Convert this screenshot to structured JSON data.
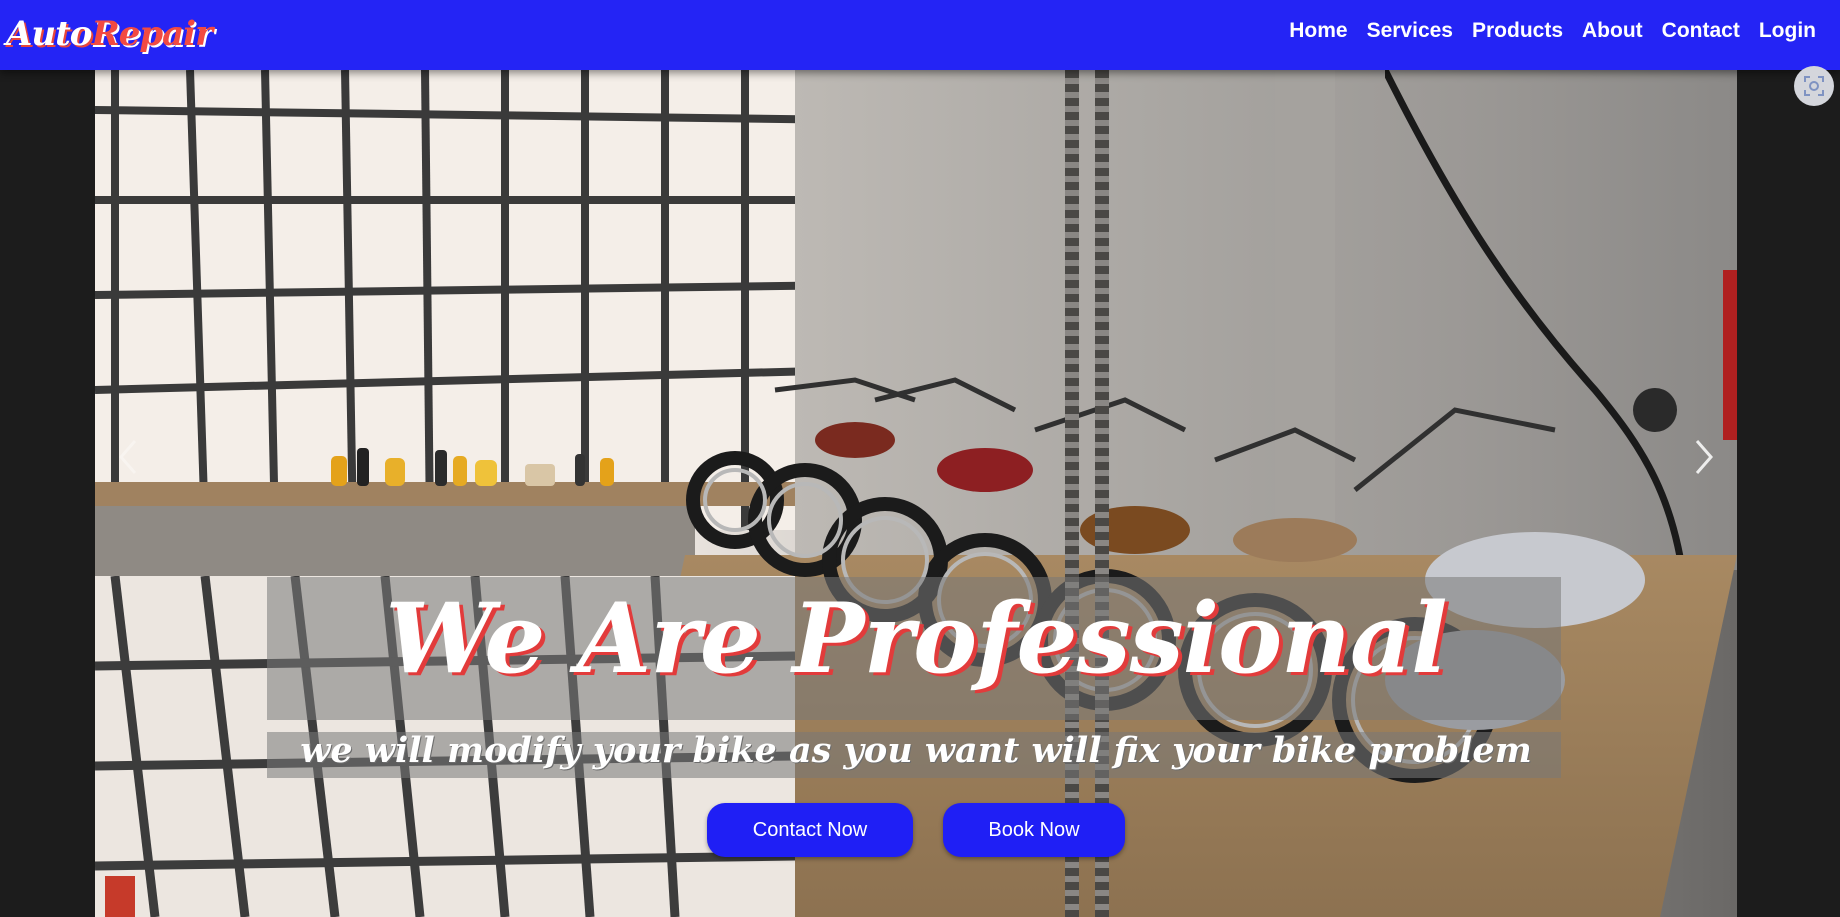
{
  "brand": {
    "part1": "Auto",
    "part2": "Repair"
  },
  "nav": {
    "items": [
      {
        "label": "Home"
      },
      {
        "label": "Services"
      },
      {
        "label": "Products"
      },
      {
        "label": "About"
      },
      {
        "label": "Contact"
      },
      {
        "label": "Login"
      }
    ]
  },
  "hero": {
    "title": "We Are Professional",
    "subtitle": "we will modify your bike as you want will fix your bike problem",
    "buttons": {
      "contact_label": "Contact Now",
      "book_label": "Book Now"
    },
    "arrows": {
      "prev_icon": "chevron-left-icon",
      "next_icon": "chevron-right-icon"
    }
  },
  "colors": {
    "navbar": "#2424f5",
    "brand_accent": "#f24a42",
    "button": "#1f1ff5",
    "title_shadow": "#e23b3b",
    "page_background": "#1c1c1c"
  },
  "icons": {
    "screenshot_tool": "screen-capture-icon"
  }
}
